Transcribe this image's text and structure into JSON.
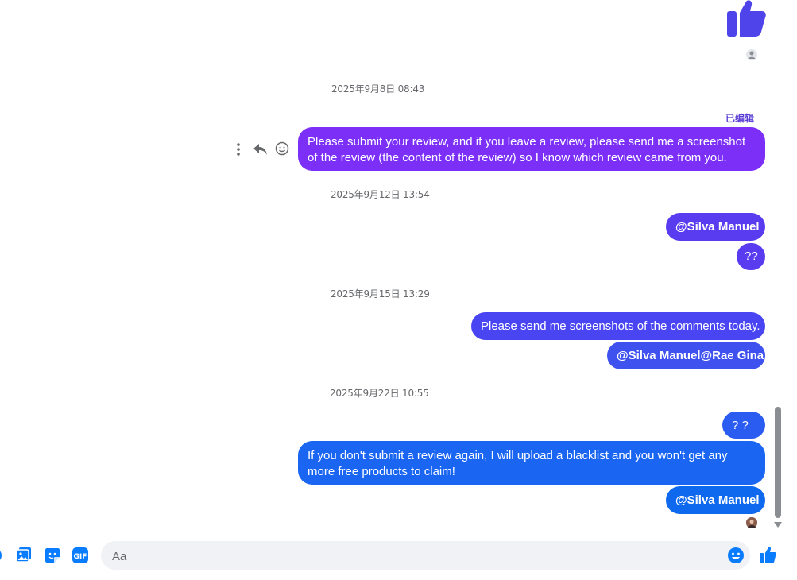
{
  "messages": {
    "edited_label": "已编辑",
    "groups": [
      {
        "timestamp": "2025年9月8日 08:43"
      },
      {
        "timestamp": "2025年9月12日 13:54"
      },
      {
        "timestamp": "2025年9月15日 13:29"
      },
      {
        "timestamp": "2025年9月22日 10:55"
      }
    ],
    "bubbles": [
      "Please submit your review, and if you leave a review, please send me a screenshot of the review (the content of the review) so I know which review came from you.",
      "@Silva Manuel",
      "??",
      "Please send me screenshots of the comments today.",
      "@Silva Manuel@Rae Gina",
      "? ?",
      "If you don't submit a review again, I will upload a blacklist and you won't get any more free products to claim!",
      "@Silva Manuel"
    ]
  },
  "composer": {
    "placeholder": "Aa"
  },
  "icons": {
    "thumbs_up_large": "thumbs-up-icon",
    "more": "more-vertical-icon",
    "reply": "reply-icon",
    "react": "emoji-icon",
    "add": "plus-circle-icon",
    "photo": "photo-icon",
    "sticker": "sticker-icon",
    "gif": "gif-icon",
    "emoji": "emoji-icon",
    "like": "thumbs-up-icon"
  },
  "colors": {
    "bubble_purple": "#7b2ff7",
    "bubble_violet": "#5a3cf0",
    "bubble_indigo": "#4a45f2",
    "bubble_blue": "#1a66f2",
    "bubble_blue_last": "#0e69ef",
    "accent": "#0a7cff"
  }
}
